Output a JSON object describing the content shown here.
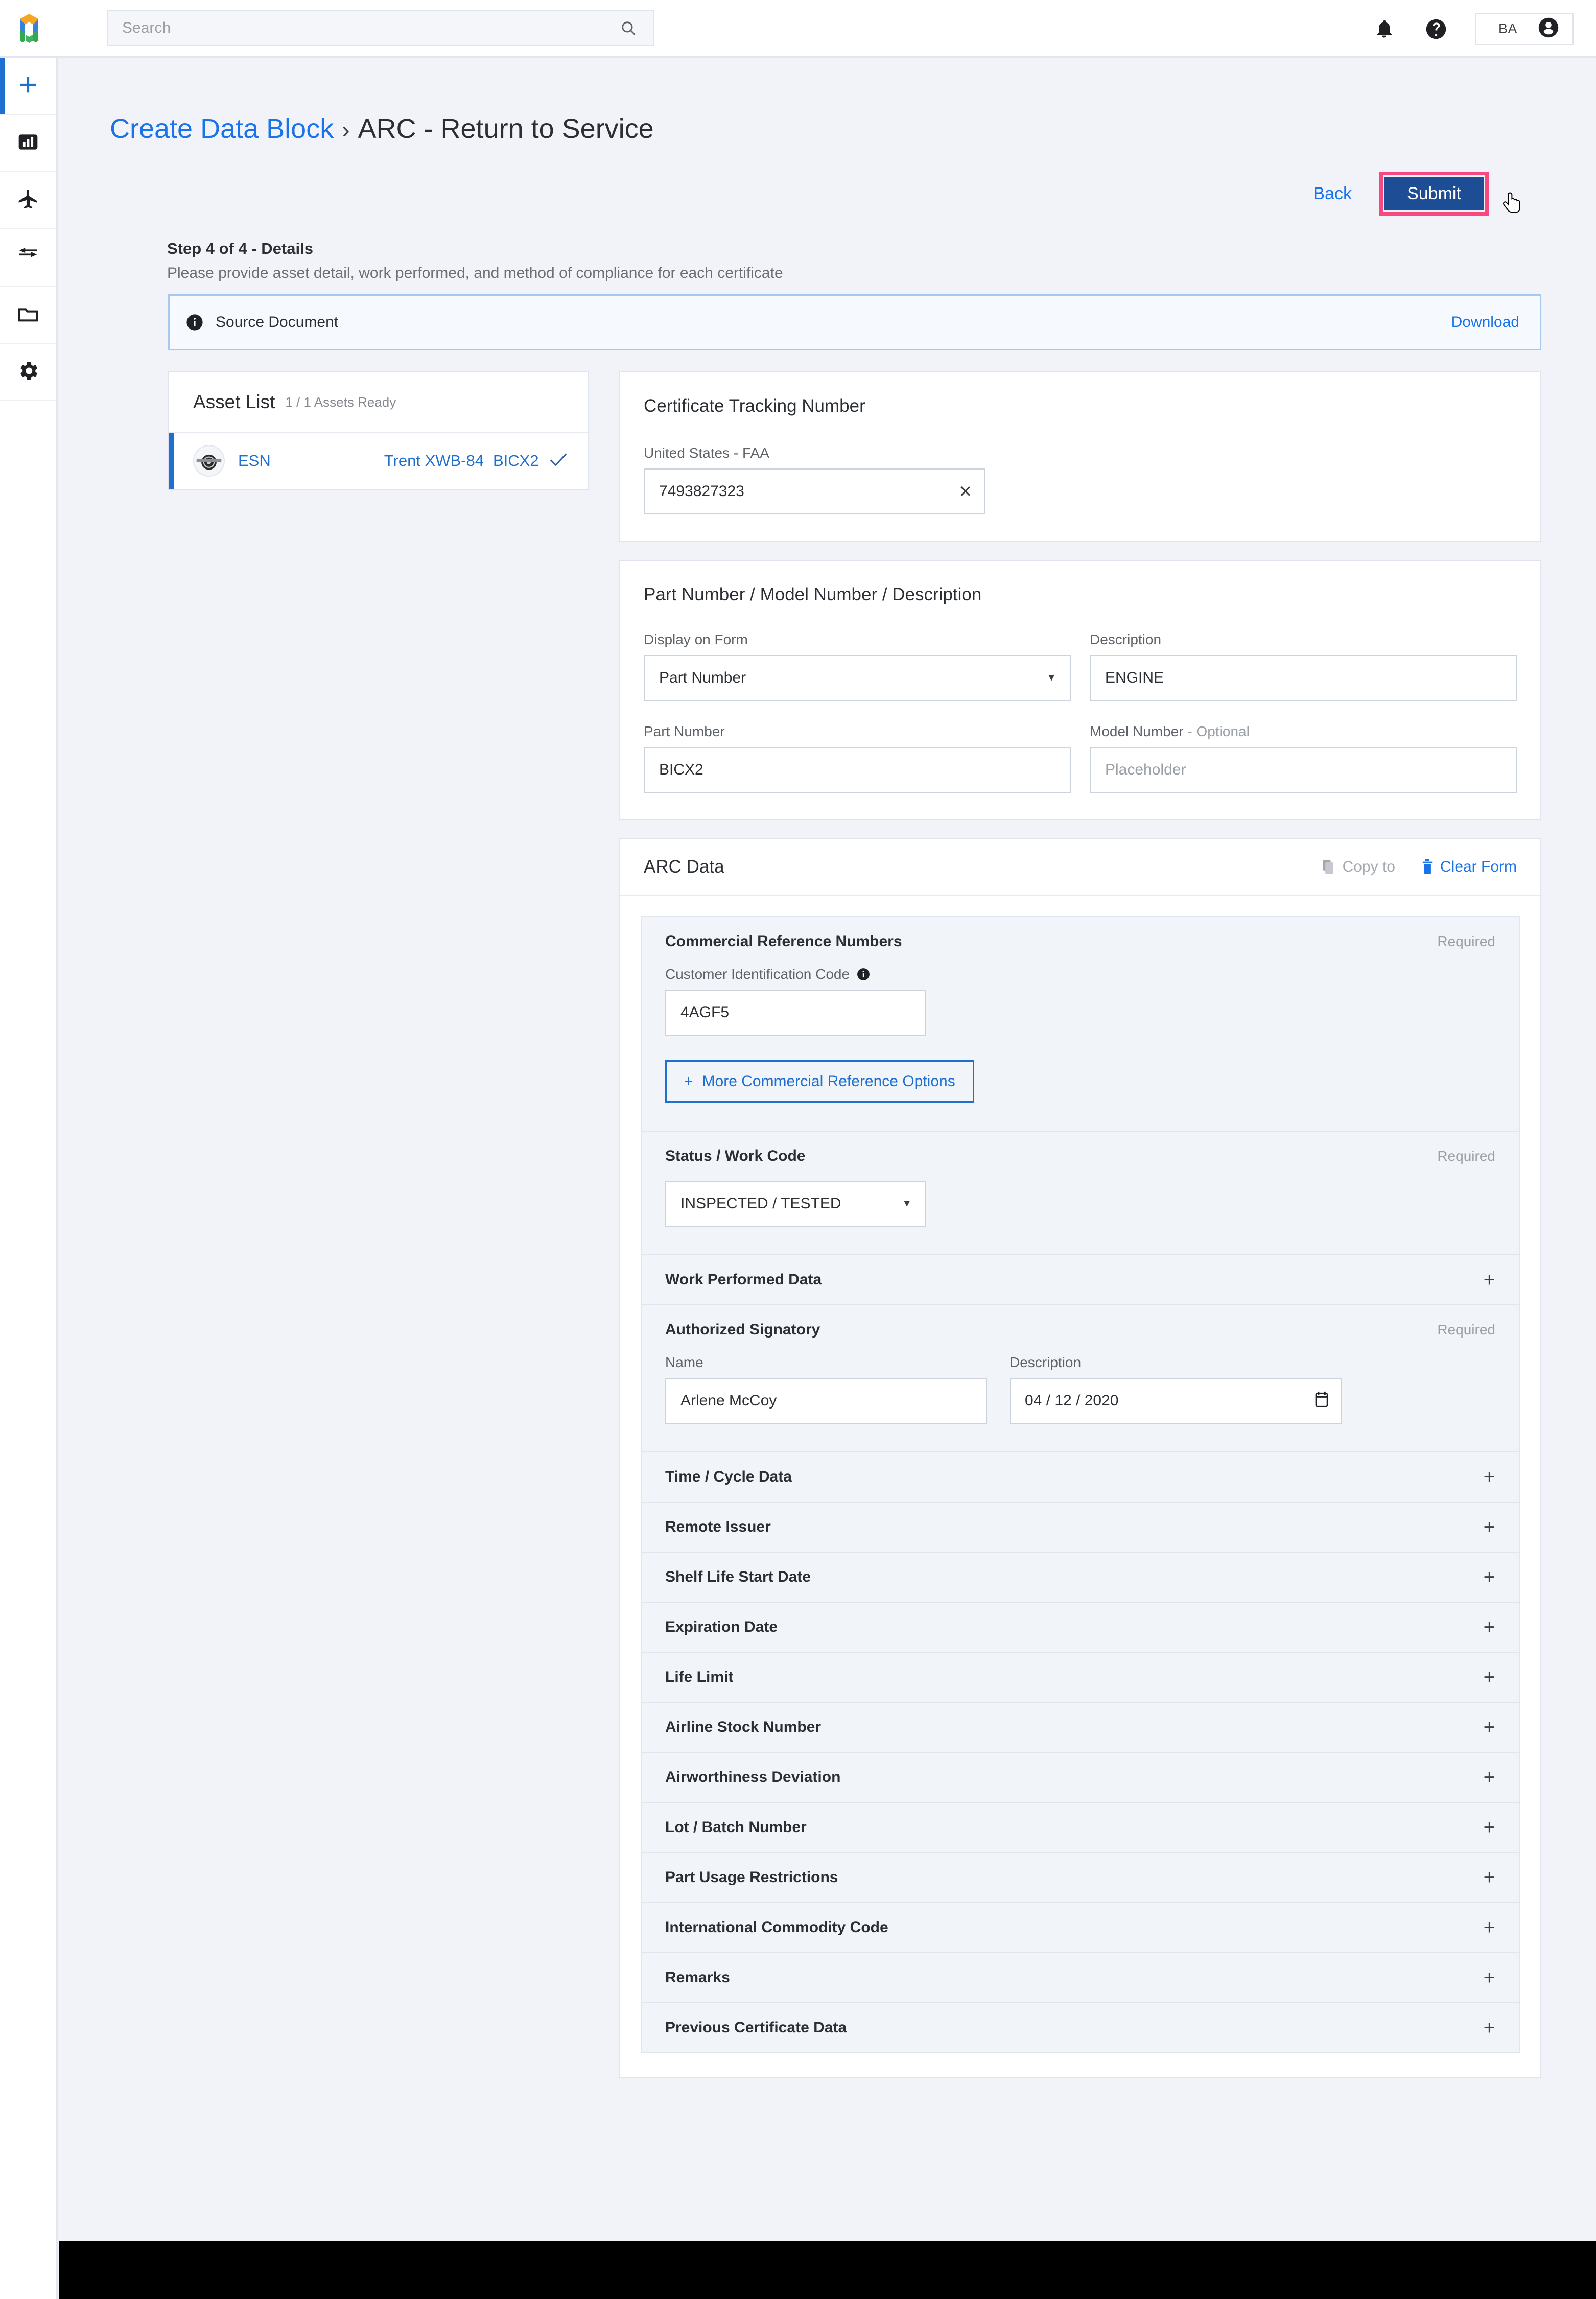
{
  "topbar": {
    "logo_icon": "hexagon-logo-icon",
    "search": {
      "placeholder": "Search",
      "value": "",
      "icon": "search-icon"
    },
    "notifications_icon": "bell-icon",
    "help_icon": "help-circle-icon",
    "user_initials": "BA",
    "avatar_icon": "account-circle-icon"
  },
  "sidebar": {
    "items": [
      {
        "name": "create",
        "icon": "plus-icon",
        "active": true
      },
      {
        "name": "dashboard",
        "icon": "bar-chart-icon",
        "active": false
      },
      {
        "name": "fleet",
        "icon": "airplane-icon",
        "active": false
      },
      {
        "name": "transfers",
        "icon": "compare-arrows-icon",
        "active": false
      },
      {
        "name": "documents",
        "icon": "folder-icon",
        "active": false
      },
      {
        "name": "settings",
        "icon": "gear-icon",
        "active": false
      }
    ]
  },
  "header": {
    "breadcrumb_link": "Create Data Block",
    "breadcrumb_separator": "›",
    "breadcrumb_current": "ARC - Return to Service",
    "back_label": "Back",
    "submit_label": "Submit",
    "submit_highlight_color": "#f7497f",
    "submit_bg_color": "#1d4d94",
    "step_title": "Step 4 of 4 - Details",
    "step_subtitle": "Please provide asset detail, work performed, and method of compliance for each certificate"
  },
  "source_document": {
    "icon": "info-icon",
    "label": "Source Document",
    "download_label": "Download"
  },
  "asset_list": {
    "title": "Asset List",
    "count_label": "1 / 1 Assets Ready",
    "rows": [
      {
        "thumb_icon": "engine-thumbnail-icon",
        "type": "ESN",
        "model": "Trent XWB-84",
        "part_number": "BICX2",
        "status_icon": "check-icon"
      }
    ]
  },
  "certificate_tracking": {
    "title": "Certificate Tracking Number",
    "field_label": "United States - FAA",
    "value": "7493827323",
    "clear_icon": "close-icon"
  },
  "part_section": {
    "title": "Part Number / Model Number / Description",
    "display_on_form": {
      "label": "Display on Form",
      "value": "Part Number",
      "caret_icon": "chevron-down-icon"
    },
    "description": {
      "label": "Description",
      "value": "ENGINE"
    },
    "part_number": {
      "label": "Part Number",
      "value": "BICX2"
    },
    "model_number": {
      "label": "Model Number",
      "optional_suffix": "- Optional",
      "value": "",
      "placeholder": "Placeholder"
    }
  },
  "arc_data": {
    "title": "ARC Data",
    "copy_to": {
      "label": "Copy to",
      "icon": "copy-icon",
      "enabled": false
    },
    "clear_form": {
      "label": "Clear Form",
      "icon": "trash-icon",
      "enabled": true
    },
    "commercial_reference": {
      "title": "Commercial Reference Numbers",
      "required_label": "Required",
      "customer_id": {
        "label": "Customer Identification Code",
        "info_icon": "info-icon",
        "value": "4AGF5"
      },
      "more_options_label": "More Commercial Reference Options",
      "more_options_icon": "plus-icon"
    },
    "status_work_code": {
      "title": "Status / Work Code",
      "required_label": "Required",
      "value": "INSPECTED / TESTED",
      "caret_icon": "chevron-down-icon"
    },
    "work_performed": {
      "title": "Work Performed Data",
      "expand_icon": "plus-icon"
    },
    "authorized_signatory": {
      "title": "Authorized Signatory",
      "required_label": "Required",
      "name": {
        "label": "Name",
        "value": "Arlene McCoy"
      },
      "date": {
        "label": "Description",
        "value": "04 / 12 / 2020",
        "calendar_icon": "calendar-icon"
      }
    },
    "collapsed_sections": [
      {
        "title": "Time / Cycle Data",
        "expand_icon": "plus-icon"
      },
      {
        "title": "Remote Issuer",
        "expand_icon": "plus-icon"
      },
      {
        "title": "Shelf Life Start Date",
        "expand_icon": "plus-icon"
      },
      {
        "title": "Expiration Date",
        "expand_icon": "plus-icon"
      },
      {
        "title": "Life Limit",
        "expand_icon": "plus-icon"
      },
      {
        "title": "Airline Stock Number",
        "expand_icon": "plus-icon"
      },
      {
        "title": "Airworthiness Deviation",
        "expand_icon": "plus-icon"
      },
      {
        "title": "Lot / Batch Number",
        "expand_icon": "plus-icon"
      },
      {
        "title": "Part Usage Restrictions",
        "expand_icon": "plus-icon"
      },
      {
        "title": "International Commodity Code",
        "expand_icon": "plus-icon"
      },
      {
        "title": "Remarks",
        "expand_icon": "plus-icon"
      },
      {
        "title": "Previous Certificate Data",
        "expand_icon": "plus-icon"
      }
    ]
  }
}
